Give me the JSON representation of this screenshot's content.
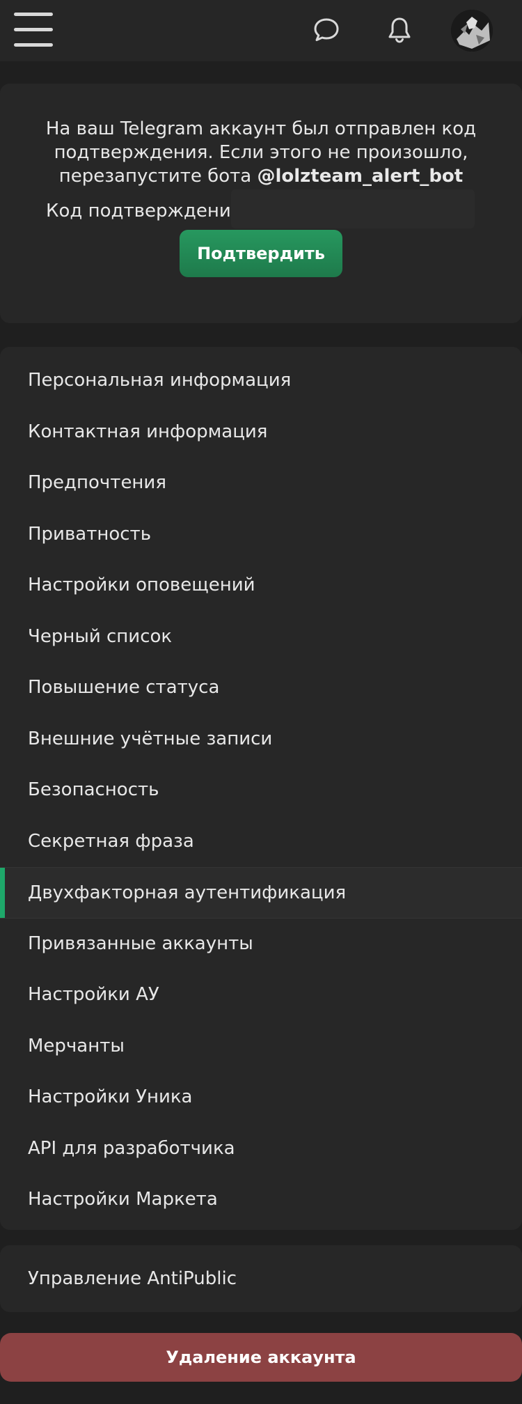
{
  "header": {
    "menu_icon": "hamburger-menu-icon",
    "chat_icon": "chat-bubble-icon",
    "bell_icon": "bell-icon",
    "avatar": "user-avatar"
  },
  "verification": {
    "message_line1": "На ваш Telegram аккаунт был отправлен код",
    "message_line2": "подтверждения. Если этого не произошло,",
    "message_line3_prefix": "перезапустите бота ",
    "bot_name": "@lolzteam_alert_bot",
    "code_label": "Код подтверждения:",
    "code_value": "",
    "confirm_label": "Подтвердить"
  },
  "menu": {
    "items": [
      {
        "label": "Персональная информация"
      },
      {
        "label": "Контактная информация"
      },
      {
        "label": "Предпочтения"
      },
      {
        "label": "Приватность"
      },
      {
        "label": "Настройки оповещений"
      },
      {
        "label": "Черный список"
      },
      {
        "label": "Повышение статуса"
      },
      {
        "label": "Внешние учётные записи"
      },
      {
        "label": "Безопасность"
      },
      {
        "label": "Секретная фраза"
      },
      {
        "label": "Двухфакторная аутентификация"
      },
      {
        "label": "Привязанные аккаунты"
      },
      {
        "label": "Настройки АУ"
      },
      {
        "label": "Мерчанты"
      },
      {
        "label": "Настройки Уника"
      },
      {
        "label": "API для разработчика"
      },
      {
        "label": "Настройки Маркета"
      }
    ],
    "active_index": 10,
    "active_color": "#1ea86a"
  },
  "antipublic": {
    "label": "Управление AntiPublic"
  },
  "delete_account": {
    "label": "Удаление аккаунта",
    "color": "#8c4243"
  },
  "colors": {
    "background": "#1f1f1f",
    "card": "#272727",
    "accent_green": "#1e7a4b"
  }
}
